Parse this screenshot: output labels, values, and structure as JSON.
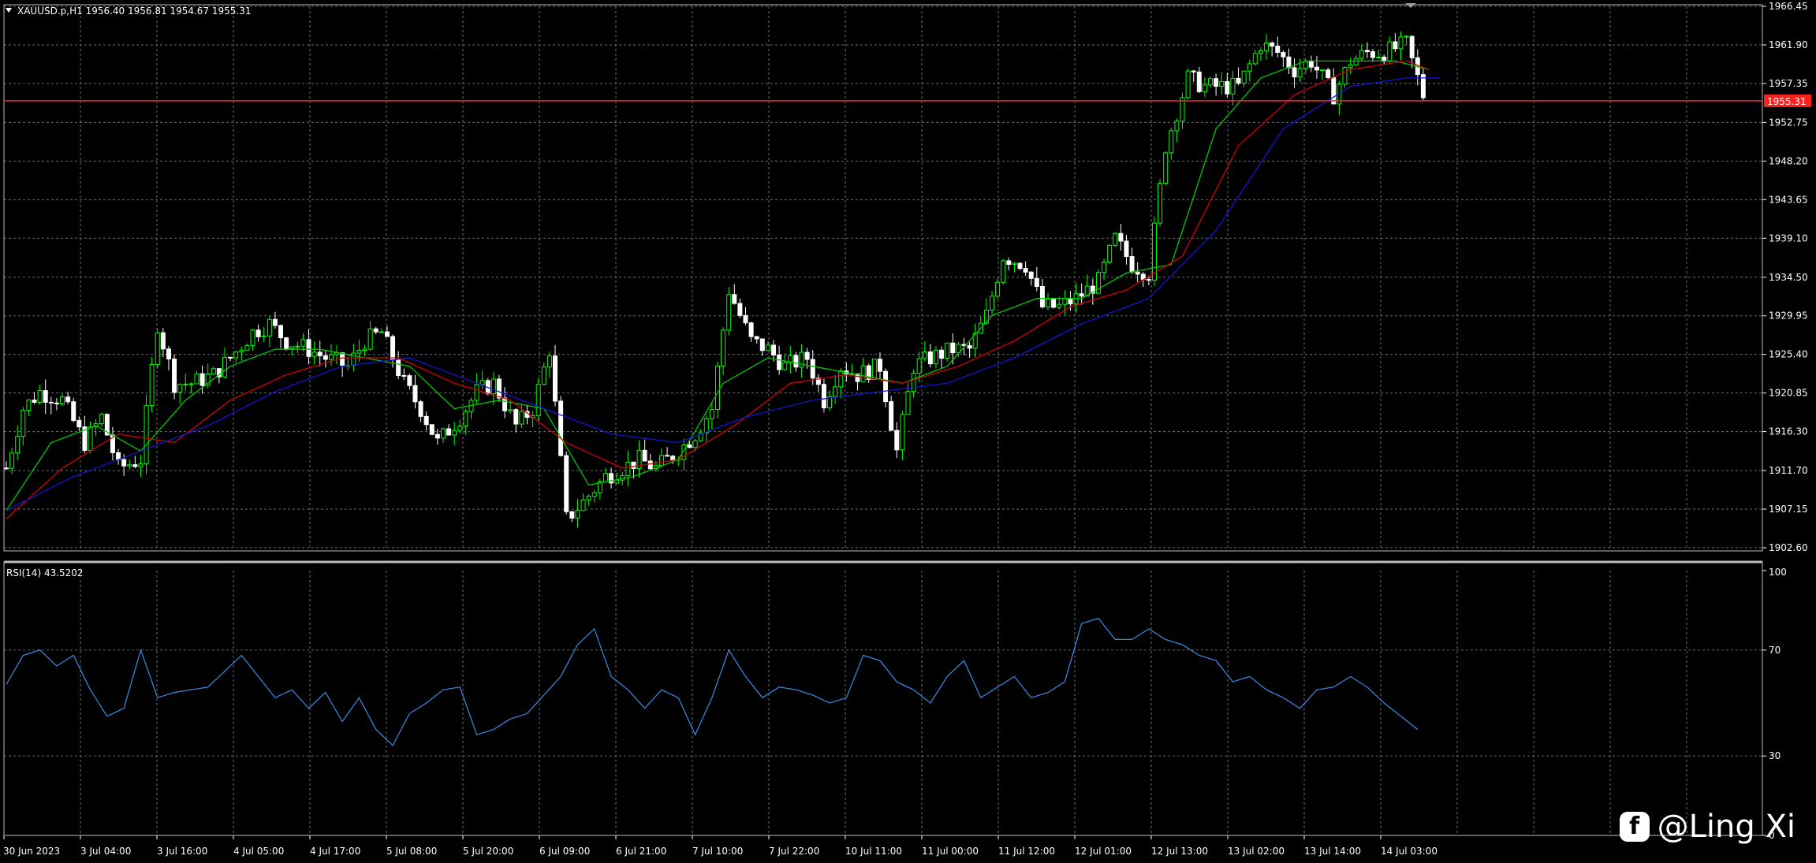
{
  "header": {
    "symbol_label": "XAUUSD.p,H1  1956.40 1956.81 1954.67 1955.31",
    "rsi_label": "RSI(14) 43.5202",
    "current_price": "1955.31"
  },
  "colors": {
    "background": "#000000",
    "grid": "#6b6b6b",
    "bull_candle": "#00ff00",
    "bear_candle": "#ffffff",
    "ma_fast": "#00c800",
    "ma_mid": "#d40000",
    "ma_slow": "#1414d4",
    "rsi_line": "#3c8ce6",
    "price_line": "#ff2020"
  },
  "watermark": {
    "icon": "facebook-icon",
    "text": "@Ling Xi"
  },
  "chart_data": [
    {
      "type": "candlestick",
      "title": "XAUUSD.p,H1",
      "ylim": [
        1902.6,
        1966.45
      ],
      "y_ticks": [
        "1966.45",
        "1961.90",
        "1957.35",
        "1952.75",
        "1948.20",
        "1943.65",
        "1939.10",
        "1934.50",
        "1929.95",
        "1925.40",
        "1920.85",
        "1916.30",
        "1911.70",
        "1907.15",
        "1902.60"
      ],
      "x_ticks": [
        "30 Jun 2023",
        "3 Jul 04:00",
        "3 Jul 16:00",
        "4 Jul 05:00",
        "4 Jul 17:00",
        "5 Jul 08:00",
        "5 Jul 20:00",
        "6 Jul 09:00",
        "6 Jul 21:00",
        "7 Jul 10:00",
        "7 Jul 22:00",
        "10 Jul 11:00",
        "11 Jul 00:00",
        "11 Jul 12:00",
        "12 Jul 01:00",
        "12 Jul 13:00",
        "13 Jul 02:00",
        "13 Jul 14:00",
        "14 Jul 03:00"
      ],
      "close_path": [
        [
          0,
          1912
        ],
        [
          3,
          1919
        ],
        [
          6,
          1921
        ],
        [
          10,
          1920
        ],
        [
          14,
          1915
        ],
        [
          17,
          1918
        ],
        [
          20,
          1912
        ],
        [
          24,
          1913
        ],
        [
          27,
          1929
        ],
        [
          30,
          1922
        ],
        [
          33,
          1922
        ],
        [
          37,
          1923
        ],
        [
          40,
          1925
        ],
        [
          44,
          1928
        ],
        [
          47,
          1929
        ],
        [
          50,
          1927
        ],
        [
          54,
          1926
        ],
        [
          57,
          1925
        ],
        [
          61,
          1924
        ],
        [
          64,
          1927
        ],
        [
          67,
          1928
        ],
        [
          71,
          1922
        ],
        [
          74,
          1919
        ],
        [
          77,
          1915
        ],
        [
          81,
          1918
        ],
        [
          84,
          1921
        ],
        [
          87,
          1922
        ],
        [
          91,
          1917
        ],
        [
          94,
          1919
        ],
        [
          97,
          1926
        ],
        [
          100,
          1906
        ],
        [
          103,
          1908
        ],
        [
          107,
          1911
        ],
        [
          110,
          1912
        ],
        [
          113,
          1913
        ],
        [
          116,
          1912
        ],
        [
          120,
          1914
        ],
        [
          123,
          1916
        ],
        [
          126,
          1919
        ],
        [
          129,
          1933
        ],
        [
          133,
          1927
        ],
        [
          136,
          1926
        ],
        [
          139,
          1924
        ],
        [
          143,
          1925
        ],
        [
          146,
          1920
        ],
        [
          149,
          1924
        ],
        [
          152,
          1923
        ],
        [
          156,
          1924
        ],
        [
          159,
          1914
        ],
        [
          162,
          1924
        ],
        [
          165,
          1925
        ],
        [
          169,
          1926
        ],
        [
          172,
          1926
        ],
        [
          175,
          1930
        ],
        [
          178,
          1937
        ],
        [
          182,
          1936
        ],
        [
          185,
          1931
        ],
        [
          188,
          1931
        ],
        [
          191,
          1932
        ],
        [
          195,
          1934
        ],
        [
          198,
          1939
        ],
        [
          201,
          1936
        ],
        [
          204,
          1935
        ],
        [
          207,
          1950
        ],
        [
          211,
          1958
        ],
        [
          214,
          1957
        ],
        [
          217,
          1957
        ],
        [
          220,
          1957
        ],
        [
          224,
          1962
        ],
        [
          227,
          1961
        ],
        [
          230,
          1959
        ],
        [
          233,
          1960
        ],
        [
          237,
          1956
        ],
        [
          240,
          1960
        ],
        [
          243,
          1961
        ],
        [
          246,
          1961
        ],
        [
          250,
          1962
        ],
        [
          253,
          1956
        ]
      ],
      "series": [
        {
          "name": "",
          "color": "#00c800",
          "values": [
            [
              0,
              1907
            ],
            [
              8,
              1915
            ],
            [
              16,
              1917
            ],
            [
              24,
              1914
            ],
            [
              32,
              1920
            ],
            [
              40,
              1924
            ],
            [
              48,
              1926
            ],
            [
              56,
              1926
            ],
            [
              64,
              1925
            ],
            [
              72,
              1924
            ],
            [
              80,
              1919
            ],
            [
              88,
              1920
            ],
            [
              96,
              1919
            ],
            [
              104,
              1910
            ],
            [
              112,
              1911
            ],
            [
              120,
              1913
            ],
            [
              128,
              1922
            ],
            [
              136,
              1925
            ],
            [
              144,
              1924
            ],
            [
              152,
              1923
            ],
            [
              160,
              1922
            ],
            [
              168,
              1924
            ],
            [
              176,
              1930
            ],
            [
              184,
              1932
            ],
            [
              192,
              1932
            ],
            [
              200,
              1935
            ],
            [
              208,
              1936
            ],
            [
              216,
              1952
            ],
            [
              224,
              1958
            ],
            [
              232,
              1960
            ],
            [
              240,
              1960
            ],
            [
              248,
              1960
            ],
            [
              254,
              1959
            ]
          ]
        },
        {
          "name": "",
          "color": "#d40000",
          "values": [
            [
              0,
              1906
            ],
            [
              10,
              1912
            ],
            [
              20,
              1916
            ],
            [
              30,
              1915
            ],
            [
              40,
              1920
            ],
            [
              50,
              1923
            ],
            [
              60,
              1925
            ],
            [
              70,
              1925
            ],
            [
              80,
              1922
            ],
            [
              90,
              1920
            ],
            [
              100,
              1915
            ],
            [
              110,
              1912
            ],
            [
              120,
              1913
            ],
            [
              130,
              1917
            ],
            [
              140,
              1922
            ],
            [
              150,
              1923
            ],
            [
              160,
              1922
            ],
            [
              170,
              1924
            ],
            [
              180,
              1927
            ],
            [
              190,
              1931
            ],
            [
              200,
              1933
            ],
            [
              210,
              1937
            ],
            [
              220,
              1950
            ],
            [
              230,
              1956
            ],
            [
              240,
              1959
            ],
            [
              250,
              1960
            ],
            [
              254,
              1959
            ]
          ]
        },
        {
          "name": "",
          "color": "#1414d4",
          "values": [
            [
              0,
              1907
            ],
            [
              12,
              1911
            ],
            [
              24,
              1914
            ],
            [
              36,
              1917
            ],
            [
              48,
              1921
            ],
            [
              60,
              1924
            ],
            [
              72,
              1925
            ],
            [
              84,
              1922
            ],
            [
              96,
              1919
            ],
            [
              108,
              1916
            ],
            [
              120,
              1915
            ],
            [
              132,
              1918
            ],
            [
              144,
              1920
            ],
            [
              156,
              1921
            ],
            [
              168,
              1922
            ],
            [
              180,
              1925
            ],
            [
              192,
              1929
            ],
            [
              204,
              1932
            ],
            [
              216,
              1940
            ],
            [
              228,
              1952
            ],
            [
              240,
              1957
            ],
            [
              250,
              1958
            ],
            [
              256,
              1958
            ]
          ]
        }
      ]
    },
    {
      "type": "line",
      "title": "RSI(14) 43.5202",
      "ylim": [
        0,
        100
      ],
      "y_ticks": [
        "100",
        "70",
        "30",
        "0"
      ],
      "series": [
        {
          "name": "",
          "color": "#3c8ce6",
          "values": [
            [
              0,
              57
            ],
            [
              3,
              68
            ],
            [
              6,
              70
            ],
            [
              9,
              64
            ],
            [
              12,
              68
            ],
            [
              15,
              55
            ],
            [
              18,
              45
            ],
            [
              21,
              48
            ],
            [
              24,
              70
            ],
            [
              27,
              52
            ],
            [
              30,
              54
            ],
            [
              33,
              55
            ],
            [
              36,
              56
            ],
            [
              39,
              62
            ],
            [
              42,
              68
            ],
            [
              45,
              60
            ],
            [
              48,
              52
            ],
            [
              51,
              55
            ],
            [
              54,
              48
            ],
            [
              57,
              54
            ],
            [
              60,
              43
            ],
            [
              63,
              52
            ],
            [
              66,
              40
            ],
            [
              69,
              34
            ],
            [
              72,
              46
            ],
            [
              75,
              50
            ],
            [
              78,
              55
            ],
            [
              81,
              56
            ],
            [
              84,
              38
            ],
            [
              87,
              40
            ],
            [
              90,
              44
            ],
            [
              93,
              46
            ],
            [
              96,
              53
            ],
            [
              99,
              60
            ],
            [
              102,
              72
            ],
            [
              105,
              78
            ],
            [
              108,
              60
            ],
            [
              111,
              55
            ],
            [
              114,
              48
            ],
            [
              117,
              55
            ],
            [
              120,
              52
            ],
            [
              123,
              38
            ],
            [
              126,
              52
            ],
            [
              129,
              70
            ],
            [
              132,
              60
            ],
            [
              135,
              52
            ],
            [
              138,
              56
            ],
            [
              141,
              55
            ],
            [
              144,
              53
            ],
            [
              147,
              50
            ],
            [
              150,
              52
            ],
            [
              153,
              68
            ],
            [
              156,
              66
            ],
            [
              159,
              58
            ],
            [
              162,
              55
            ],
            [
              165,
              50
            ],
            [
              168,
              60
            ],
            [
              171,
              66
            ],
            [
              174,
              52
            ],
            [
              177,
              56
            ],
            [
              180,
              60
            ],
            [
              183,
              52
            ],
            [
              186,
              54
            ],
            [
              189,
              58
            ],
            [
              192,
              80
            ],
            [
              195,
              82
            ],
            [
              198,
              74
            ],
            [
              201,
              74
            ],
            [
              204,
              78
            ],
            [
              207,
              74
            ],
            [
              210,
              72
            ],
            [
              213,
              68
            ],
            [
              216,
              66
            ],
            [
              219,
              58
            ],
            [
              222,
              60
            ],
            [
              225,
              55
            ],
            [
              228,
              52
            ],
            [
              231,
              48
            ],
            [
              234,
              55
            ],
            [
              237,
              56
            ],
            [
              240,
              60
            ],
            [
              243,
              56
            ],
            [
              246,
              50
            ],
            [
              249,
              45
            ],
            [
              252,
              40
            ]
          ]
        }
      ]
    }
  ]
}
